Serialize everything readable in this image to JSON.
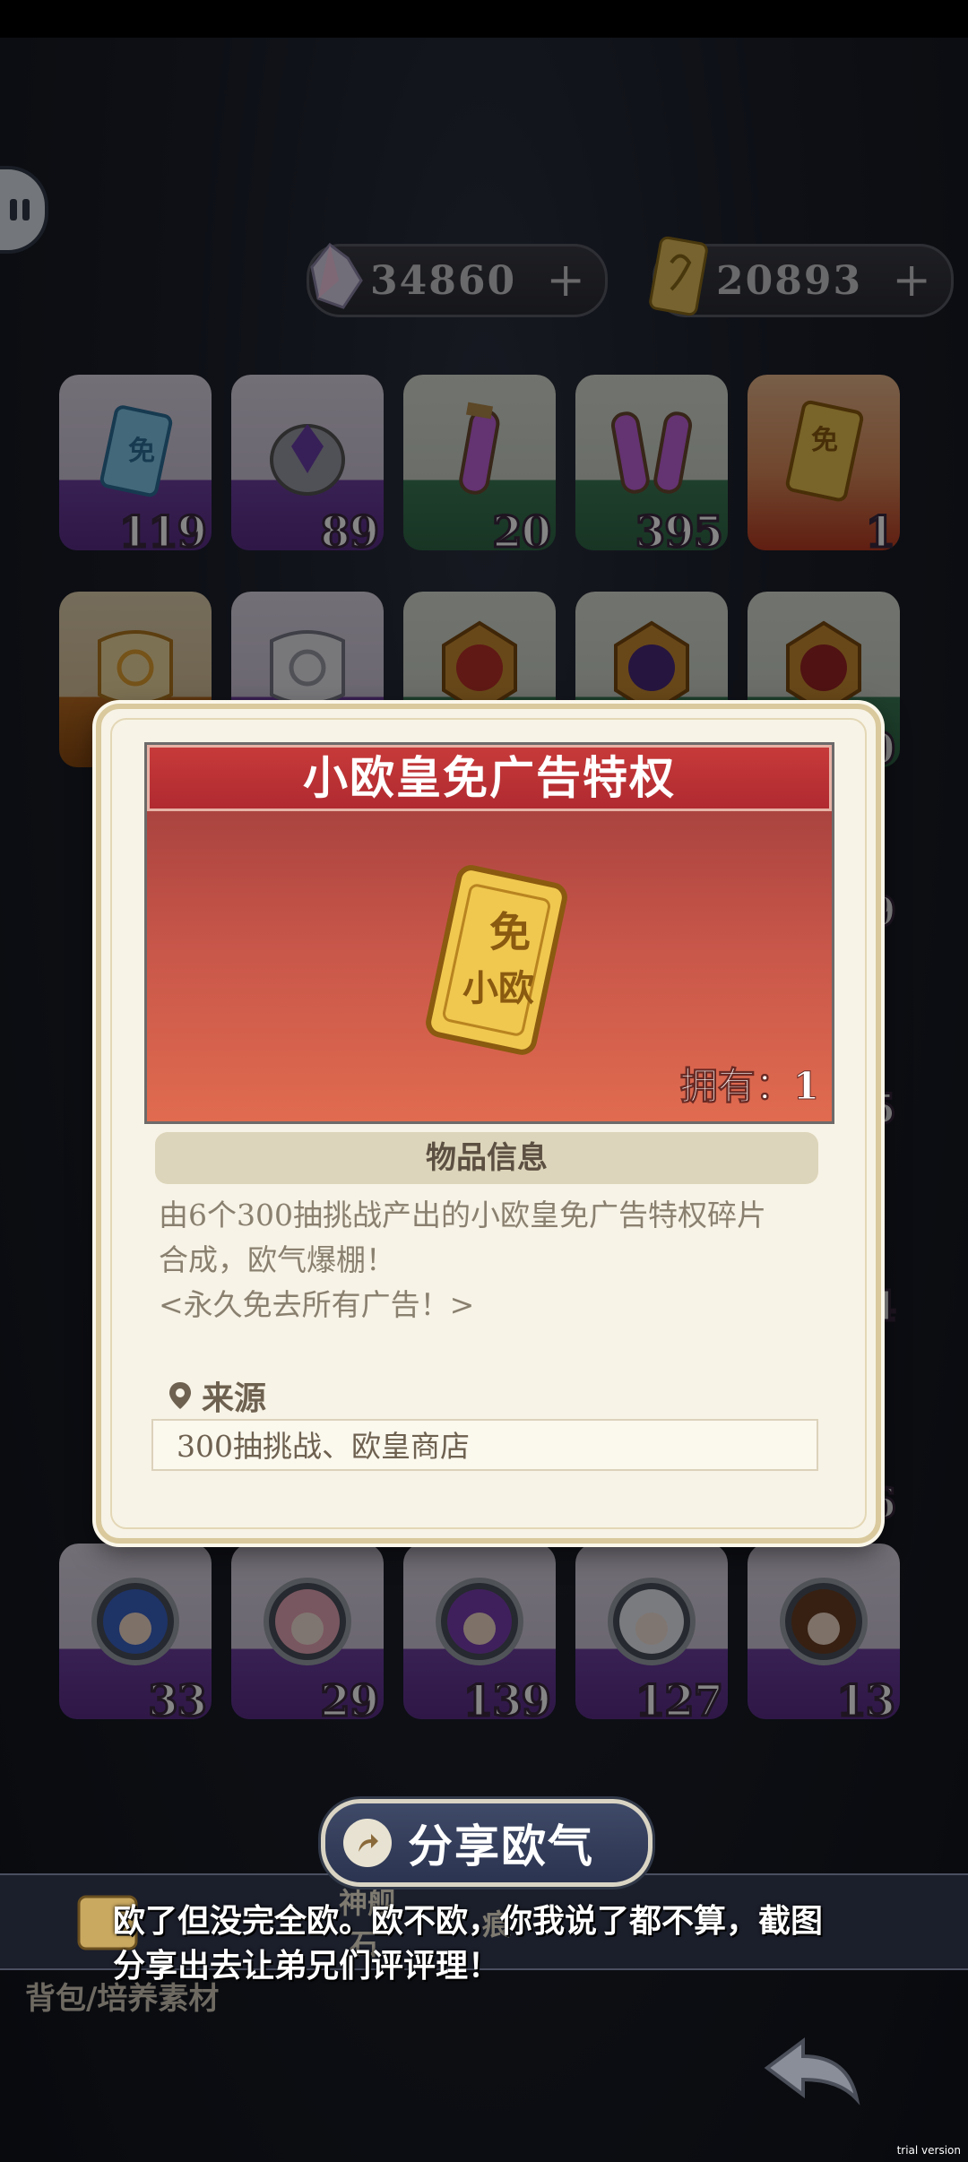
{
  "currencies": [
    {
      "name": "crystal",
      "value": "34860",
      "plus": "+"
    },
    {
      "name": "ticket",
      "value": "20893",
      "plus": "+"
    }
  ],
  "inventory": [
    {
      "icon": "ad-free-mini-ticket-icon",
      "rarity": "purple",
      "count": "119"
    },
    {
      "icon": "crystal-egg-icon",
      "rarity": "purple",
      "count": "89"
    },
    {
      "icon": "purple-potion-icon",
      "rarity": "green",
      "count": "20"
    },
    {
      "icon": "double-potion-icon",
      "rarity": "green",
      "count": "395"
    },
    {
      "icon": "gold-ticket-icon",
      "rarity": "red",
      "count": "1"
    },
    {
      "icon": "gold-scroll-icon",
      "rarity": "orange",
      "count": ""
    },
    {
      "icon": "silver-scroll-icon",
      "rarity": "purple",
      "count": ""
    },
    {
      "icon": "red-badge-icon",
      "rarity": "green",
      "count": ""
    },
    {
      "icon": "purple-badge-icon",
      "rarity": "green",
      "count": ""
    },
    {
      "icon": "red-emblem-icon",
      "rarity": "green",
      "count": "0"
    }
  ],
  "portraits": [
    {
      "icon": "portrait-blue-hair-icon",
      "count": "33"
    },
    {
      "icon": "portrait-pink-hair-icon",
      "count": "29"
    },
    {
      "icon": "portrait-purple-hair-icon",
      "count": "139"
    },
    {
      "icon": "portrait-white-hair-icon",
      "count": "127"
    },
    {
      "icon": "portrait-brown-hair-icon",
      "count": "13"
    }
  ],
  "side_counts": [
    "9",
    "5",
    "4",
    "6"
  ],
  "modal": {
    "title": "小欧皇免广告特权",
    "ticket_top": "免",
    "ticket_bottom": "小欧",
    "owned": "拥有：1",
    "section_title": "物品信息",
    "desc_line1": "由6个300抽挑战产出的小欧皇免广告特权碎片",
    "desc_line2": "合成，欧气爆棚！",
    "desc_line3": "<永久免去所有广告！>",
    "source_label": "来源",
    "source_value": "300抽挑战、欧皇商店"
  },
  "share_label": "分享欧气",
  "share_message_line1": "欧了但没完全欧。欧不欧，你我说了都不算，截图",
  "share_message_line2": "分享出去让弟兄们评评理！",
  "dim_tab_1": "神舰",
  "dim_tab_2": "石",
  "dim_tab_3": "痕",
  "breadcrumb": "背包/培养素材",
  "watermark": "trial version",
  "colors": {
    "accent_red": "#c0333a",
    "panel_bg": "#f7f3e6",
    "share_btn": "#2f3a58"
  }
}
